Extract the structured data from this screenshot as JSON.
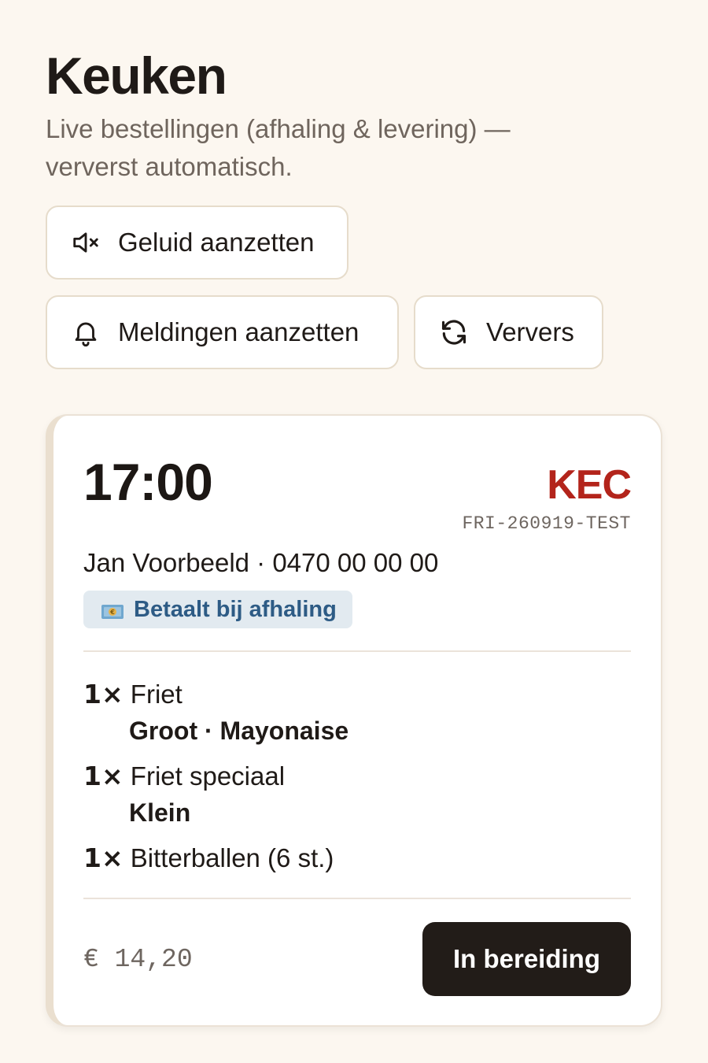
{
  "header": {
    "title": "Keuken",
    "subtitle": "Live bestellingen (afhaling & levering) — ververst automatisch."
  },
  "toolbar": {
    "sound_label": "Geluid aanzetten",
    "sound_icon": "speaker-muted-icon",
    "notify_label": "Meldingen aanzetten",
    "notify_icon": "bell-icon",
    "refresh_label": "Ververs",
    "refresh_icon": "refresh-icon"
  },
  "order": {
    "time": "17:00",
    "code": "KEC",
    "reference": "FRI-260919-TEST",
    "customer": "Jan Voorbeeld · 0470 00 00 00",
    "payment_badge": "Betaalt bij afhaling",
    "payment_icon": "money-icon",
    "items": [
      {
        "qty": "1×",
        "name": "Friet",
        "mods": "Groot · Mayonaise"
      },
      {
        "qty": "1×",
        "name": "Friet speciaal",
        "mods": "Klein"
      },
      {
        "qty": "1×",
        "name": "Bitterballen (6 st.)",
        "mods": ""
      }
    ],
    "total": "€ 14,20",
    "status_button": "In bereiding"
  },
  "colors": {
    "background": "#fcf7f0",
    "accent_code": "#b3241b",
    "badge_bg": "#e2eaf0",
    "badge_text": "#2d5b85",
    "primary_button": "#221c18"
  }
}
